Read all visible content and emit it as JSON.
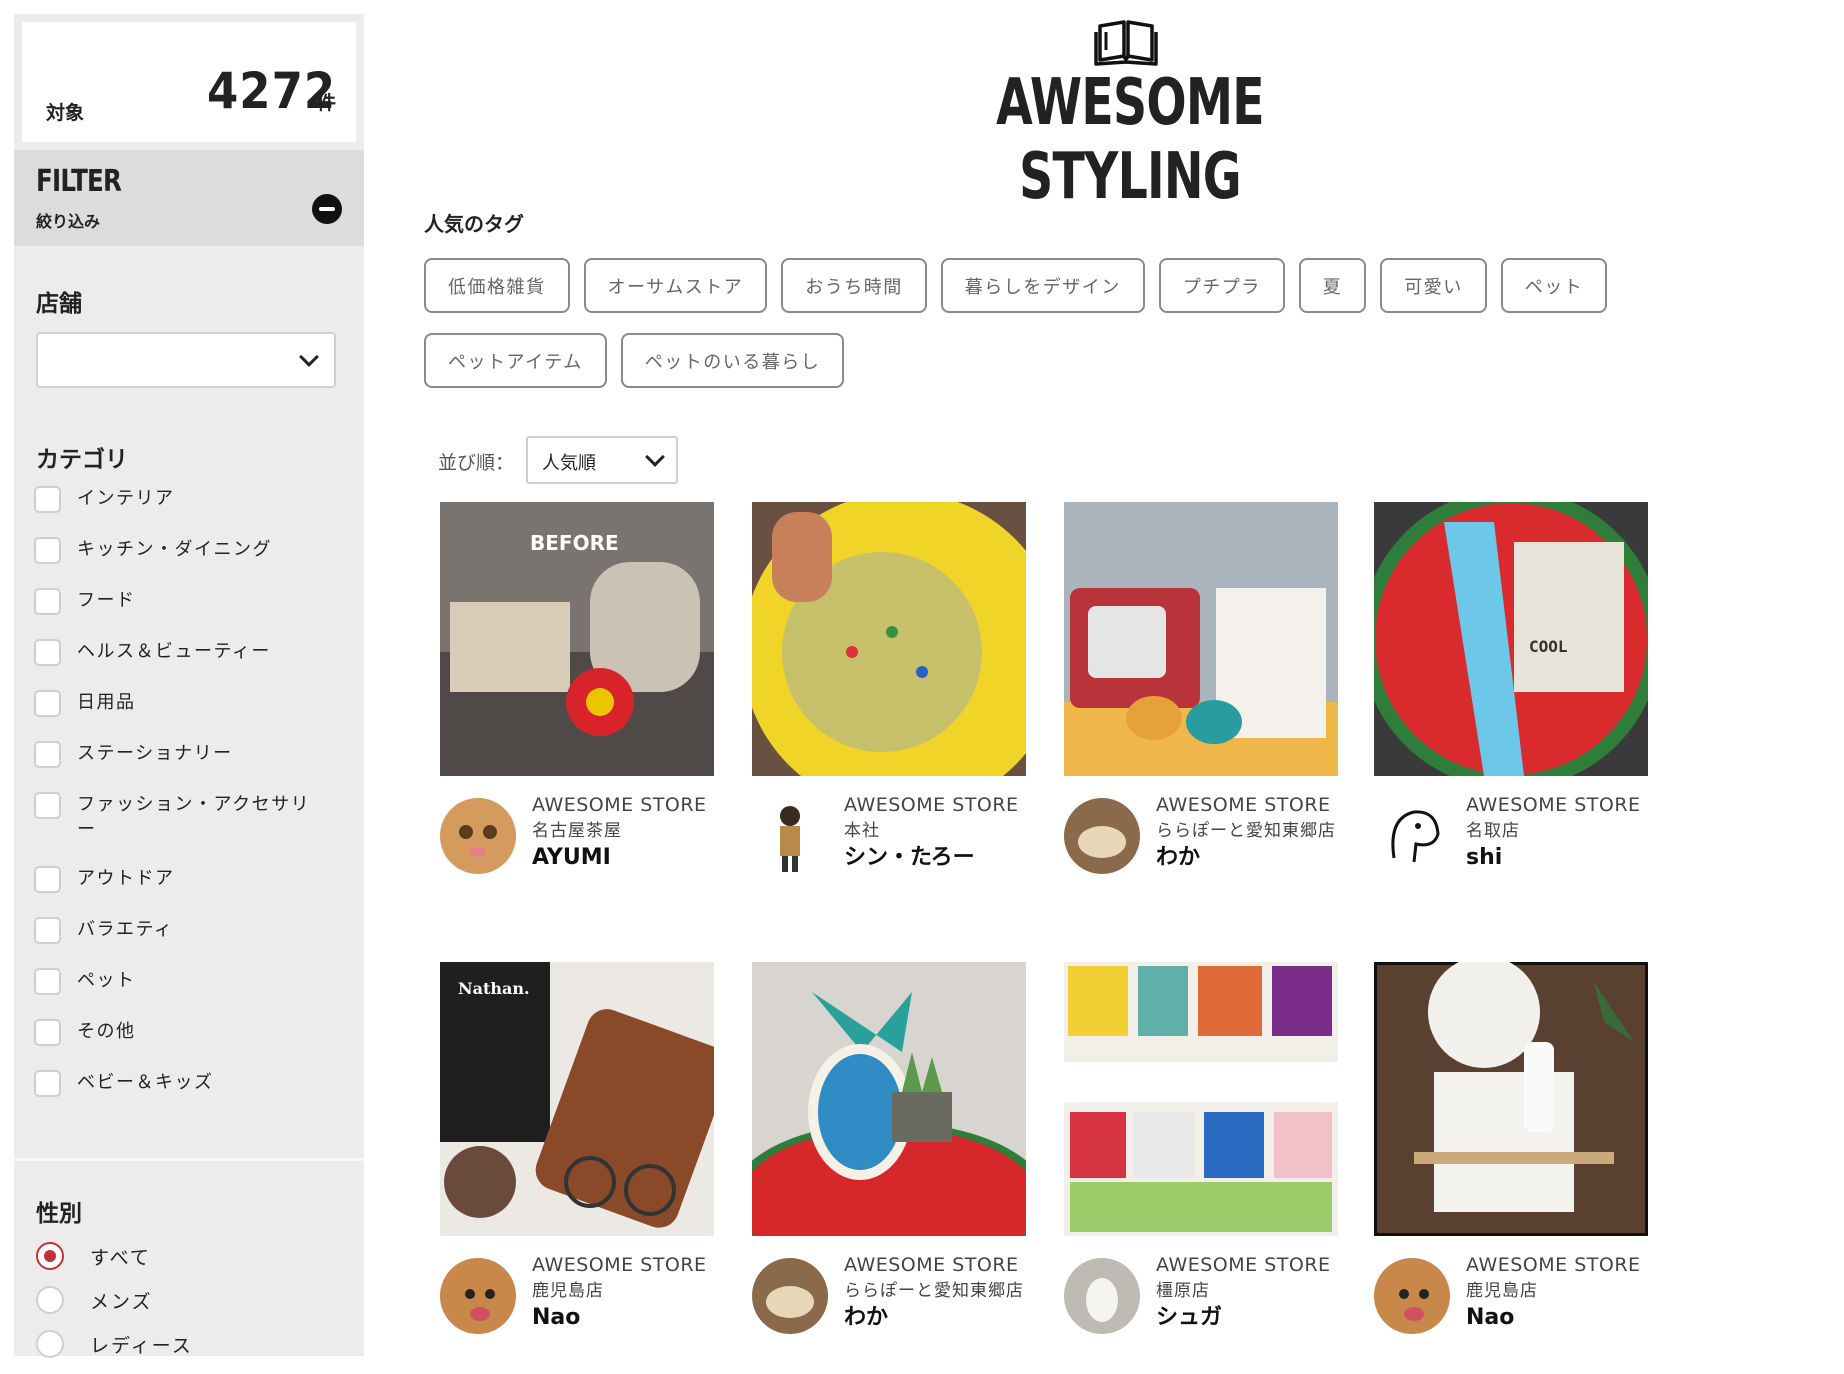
{
  "sidebar": {
    "count_label": "対象",
    "count": "4272",
    "count_unit": "件",
    "filter_title": "FILTER",
    "filter_sub": "絞り込み",
    "store_title": "店舗",
    "store_value": "",
    "category_title": "カテゴリ",
    "categories": [
      "インテリア",
      "キッチン・ダイニング",
      "フード",
      "ヘルス＆ビューティー",
      "日用品",
      "ステーショナリー",
      "ファッション・アクセサリー",
      "アウトドア",
      "バラエティ",
      "ペット",
      "その他",
      "ベビー＆キッズ"
    ],
    "gender_title": "性別",
    "genders": [
      "すべて",
      "メンズ",
      "レディース"
    ],
    "gender_selected": "すべて"
  },
  "header": {
    "brand": "AWESOME STYLING",
    "logo_icon": "open-book-icon"
  },
  "tags": {
    "heading": "人気のタグ",
    "items": [
      "低価格雑貨",
      "オーサムストア",
      "おうち時間",
      "暮らしをデザイン",
      "プチプラ",
      "夏",
      "可愛い",
      "ペット",
      "ペットアイテム",
      "ペットのいる暮らし"
    ]
  },
  "sort": {
    "label": "並び順：",
    "value": "人気順"
  },
  "posts": [
    {
      "store": "AWESOME STORE",
      "branch": "名古屋茶屋",
      "user": "AYUMI",
      "thumb_color": "#6e6a66"
    },
    {
      "store": "AWESOME STORE",
      "branch": "本社",
      "user": "シン・たろー",
      "thumb_color": "#e8c830"
    },
    {
      "store": "AWESOME STORE",
      "branch": "ららぽーと愛知東郷店",
      "user": "わか",
      "thumb_color": "#a9b4bd"
    },
    {
      "store": "AWESOME STORE",
      "branch": "名取店",
      "user": "shi",
      "thumb_color": "#3a3a3a"
    },
    {
      "store": "AWESOME STORE",
      "branch": "鹿児島店",
      "user": "Nao",
      "thumb_color": "#e9e6e2"
    },
    {
      "store": "AWESOME STORE",
      "branch": "ららぽーと愛知東郷店",
      "user": "わか",
      "thumb_color": "#d8d4cf"
    },
    {
      "store": "AWESOME STORE",
      "branch": "橿原店",
      "user": "シュガ",
      "thumb_color": "#f1efe8"
    },
    {
      "store": "AWESOME STORE",
      "branch": "鹿児島店",
      "user": "Nao",
      "thumb_color": "#5a4030"
    }
  ]
}
